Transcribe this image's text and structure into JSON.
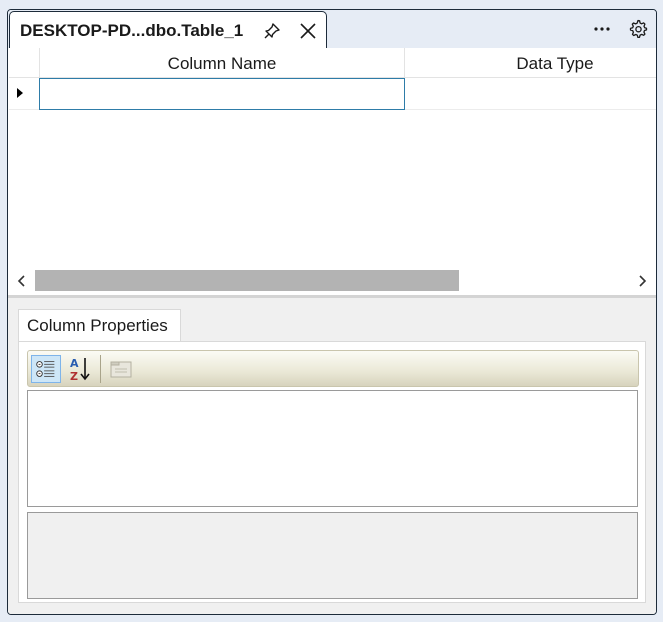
{
  "tab": {
    "title": "DESKTOP-PD...dbo.Table_1"
  },
  "toolbar_right": {
    "more_icon": "ellipsis-icon",
    "settings_icon": "gear-icon"
  },
  "grid": {
    "columns": [
      "Column Name",
      "Data Type"
    ],
    "rows": [
      {
        "column_name": "",
        "data_type": ""
      }
    ]
  },
  "properties": {
    "tab_label": "Column Properties"
  },
  "colors": {
    "window_border": "#1d2b3a",
    "selected_cell_border": "#2e7ca8",
    "scroll_thumb": "#b3b3b3"
  }
}
